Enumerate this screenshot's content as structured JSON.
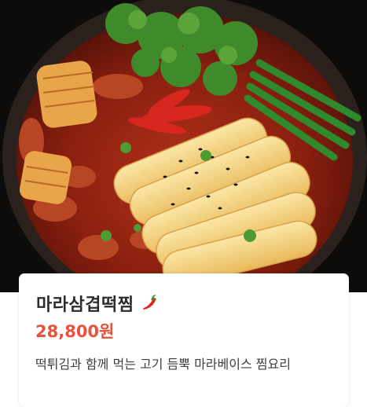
{
  "menu_item": {
    "name": "마라삼겹떡찜",
    "price": "28,800원",
    "description": "떡튀김과 함께 먹는 고기 듬뿍 마라베이스 찜요리",
    "spicy_icon": "chili-pepper-icon"
  },
  "colors": {
    "price": "#e8523c",
    "title": "#2b2b2b",
    "description": "#3e3e3e",
    "chili": "#d7261e"
  }
}
